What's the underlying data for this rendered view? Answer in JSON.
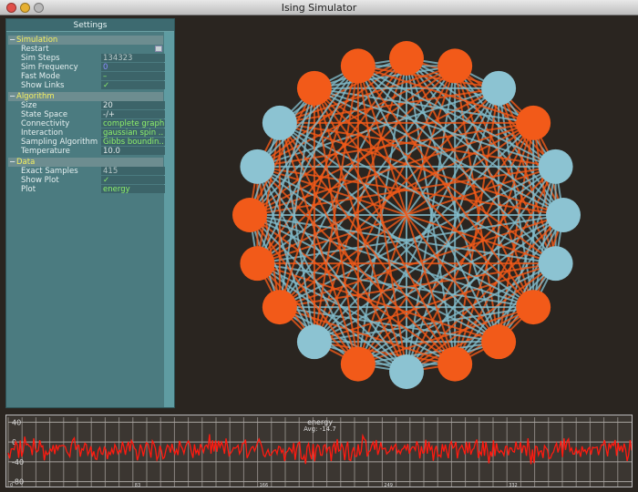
{
  "window": {
    "title": "Ising Simulator"
  },
  "settings": {
    "title": "Settings",
    "sections": [
      {
        "label": "Simulation",
        "rows": [
          {
            "label": "Restart",
            "type": "button"
          },
          {
            "label": "Sim Steps",
            "value": "134323",
            "style": "grey"
          },
          {
            "label": "Sim Frequency",
            "value": "0",
            "style": "blue"
          },
          {
            "label": "Fast Mode",
            "value": "–",
            "style": "green"
          },
          {
            "label": "Show Links",
            "value": "✓",
            "style": "green"
          }
        ]
      },
      {
        "label": "Algorithm",
        "rows": [
          {
            "label": "Size",
            "value": "20",
            "style": "white"
          },
          {
            "label": "State Space",
            "value": "-/+",
            "style": "white"
          },
          {
            "label": "Connectivity",
            "value": "complete graph",
            "style": "green"
          },
          {
            "label": "Interaction",
            "value": "gaussian spin ..",
            "style": "green"
          },
          {
            "label": "Sampling Algorithm",
            "value": "Gibbs boundin..",
            "style": "green"
          },
          {
            "label": "Temperature",
            "value": "10.0",
            "style": "white"
          }
        ]
      },
      {
        "label": "Data",
        "rows": [
          {
            "label": "Exact Samples",
            "value": "415",
            "style": "grey"
          },
          {
            "label": "Show Plot",
            "value": "✓",
            "style": "green"
          },
          {
            "label": "Plot",
            "value": "energy",
            "style": "green"
          }
        ]
      }
    ]
  },
  "graph": {
    "spins": [
      "+",
      "+",
      "-",
      "+",
      "-",
      "-",
      "-",
      "+",
      "+",
      "+",
      "-",
      "+",
      "-",
      "+",
      "+",
      "+",
      "-",
      "-",
      "+",
      "+"
    ],
    "colors": {
      "up": "#f25a19",
      "down": "#8cc3d2",
      "link_pos": "#f25a19",
      "link_neg": "#82bccb"
    }
  },
  "chart_data": {
    "type": "line",
    "title": "energy",
    "subtitle": "Avg: -14.7",
    "xlim": [
      0,
      415
    ],
    "ylim": [
      -90,
      50
    ],
    "xticks": [
      "0",
      "83",
      "166",
      "249",
      "332"
    ],
    "yticks": [
      "40",
      "0",
      "-40",
      "-80"
    ],
    "grid": true,
    "series": [
      {
        "color": "#ff1a10",
        "mean": -14.7
      }
    ]
  }
}
